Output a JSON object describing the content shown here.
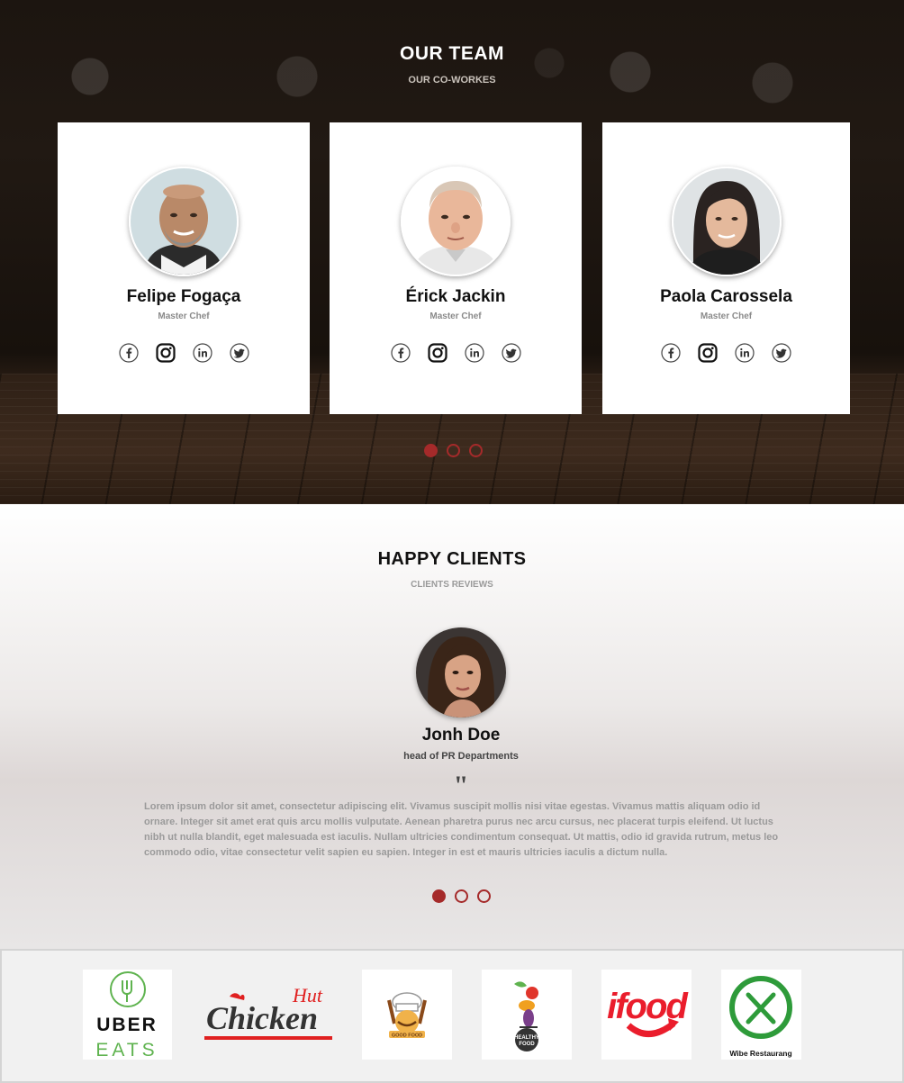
{
  "team": {
    "title": "OUR TEAM",
    "subtitle": "OUR CO-WORKES",
    "members": [
      {
        "name": "Felipe Fogaça",
        "role": "Master Chef"
      },
      {
        "name": "Érick Jackin",
        "role": "Master Chef"
      },
      {
        "name": "Paola Carossela",
        "role": "Master Chef"
      }
    ],
    "social_icons": [
      "facebook-icon",
      "instagram-icon",
      "linkedin-icon",
      "twitter-icon"
    ],
    "carousel": {
      "pages": 3,
      "active": 1
    }
  },
  "clients": {
    "title": "HAPPY CLIENTS",
    "subtitle": "CLIENTS REVIEWS",
    "review": {
      "name": "Jonh Doe",
      "role": "head of PR Departments",
      "quote_mark": "\"",
      "text": "Lorem ipsum dolor sit amet, consectetur adipiscing elit. Vivamus suscipit mollis nisi vitae egestas. Vivamus mattis aliquam odio id ornare. Integer sit amet erat quis arcu mollis vulputate. Aenean pharetra purus nec arcu cursus, nec placerat turpis eleifend. Ut luctus nibh ut nulla blandit, eget malesuada est iaculis. Nullam ultricies condimentum consequat. Ut mattis, odio id gravida rutrum, metus leo commodo odio, vitae consectetur velit sapien eu sapien. Integer in est et mauris ultricies iaculis a dictum nulla."
    },
    "carousel": {
      "pages": 3,
      "active": 1
    }
  },
  "partners": {
    "logos": [
      {
        "name": "Uber Eats",
        "line1": "UBER",
        "line2": "EATS"
      },
      {
        "name": "Chicken Hut",
        "line1": "Chicken",
        "line2": "Hut"
      },
      {
        "name": "Good Food",
        "line1": "GOOD FOOD"
      },
      {
        "name": "Healthy Food",
        "line1": "HEALTHY",
        "line2": "FOOD"
      },
      {
        "name": "iFood",
        "line1": "ifood"
      },
      {
        "name": "Wibe Restaurang",
        "line1": "Wibe Restaurang"
      }
    ]
  },
  "colors": {
    "accent": "#a52a2a",
    "uber_green": "#5fb34f",
    "ifood_red": "#ea1d2c",
    "wibe_green": "#2e9b3a"
  }
}
